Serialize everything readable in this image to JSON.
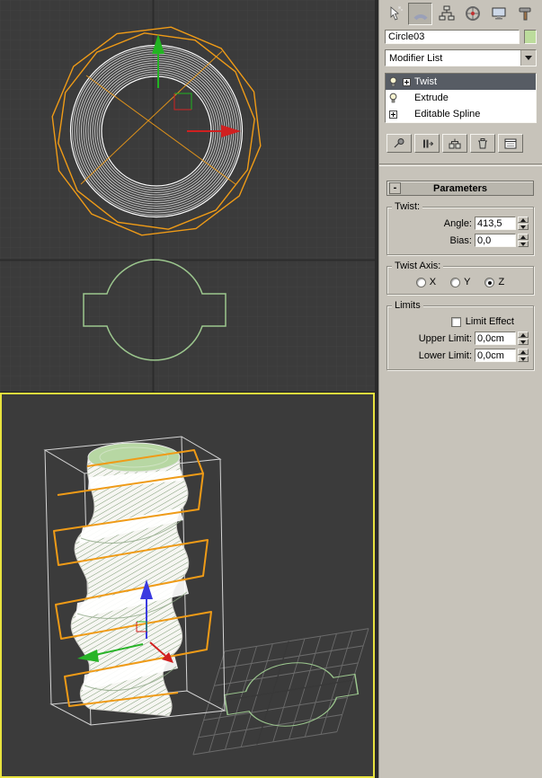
{
  "command_panel": {
    "tabs": [
      {
        "name": "create",
        "icon": "create-arrow-icon",
        "active": false
      },
      {
        "name": "modify",
        "icon": "modify-arc-icon",
        "active": true
      },
      {
        "name": "hierarchy",
        "icon": "hierarchy-boxes-icon",
        "active": false
      },
      {
        "name": "motion",
        "icon": "motion-wheel-icon",
        "active": false
      },
      {
        "name": "display",
        "icon": "display-monitor-icon",
        "active": false
      },
      {
        "name": "utilities",
        "icon": "utilities-hammer-icon",
        "active": false
      }
    ],
    "object_name": "Circle03",
    "object_color": "#bcdc9c",
    "modifier_list_label": "Modifier List",
    "modifier_stack": {
      "items": [
        {
          "label": "Twist",
          "selected": true,
          "bulb": true,
          "expandable": true
        },
        {
          "label": "Extrude",
          "selected": false,
          "bulb": true,
          "expandable": false
        },
        {
          "label": "Editable Spline",
          "selected": false,
          "bulb": false,
          "expandable": true
        }
      ]
    },
    "stack_toolbar": {
      "buttons": [
        "pin-stack",
        "show-end-result",
        "make-unique",
        "remove-modifier",
        "configure-modifier-sets"
      ]
    },
    "rollouts": {
      "parameters": {
        "title": "Parameters",
        "collapse_symbol": "-",
        "twist": {
          "title": "Twist:",
          "angle_label": "Angle:",
          "angle_value": "413,5",
          "bias_label": "Bias:",
          "bias_value": "0,0"
        },
        "twist_axis": {
          "title": "Twist Axis:",
          "options": [
            {
              "label": "X",
              "selected": false
            },
            {
              "label": "Y",
              "selected": false
            },
            {
              "label": "Z",
              "selected": true
            }
          ]
        },
        "limits": {
          "title": "Limits",
          "limit_effect_label": "Limit Effect",
          "limit_effect_checked": false,
          "upper_label": "Upper Limit:",
          "upper_value": "0,0cm",
          "lower_label": "Lower Limit:",
          "lower_value": "0,0cm"
        }
      }
    }
  },
  "viewports": {
    "top_view": {
      "active": false,
      "contents": [
        "twisted-tube-top-view",
        "twist-gizmo",
        "move-gizmo-axes",
        "profile-spline"
      ]
    },
    "perspective_view": {
      "active": true,
      "contents": [
        "twisted-extruded-tube",
        "twist-gizmo-helix",
        "axis-tripod",
        "home-grid",
        "profile-spline"
      ]
    },
    "colors": {
      "background": "#3b3b3b",
      "grid_line": "#424242",
      "gizmo_orange": "#ef9b17",
      "spline_green": "#9cc78e",
      "active_border_yellow": "#e8e33e",
      "wireframe_white": "#e8e8e8",
      "cap_green": "#b7d7a3",
      "selection_row": "#575c64"
    }
  }
}
